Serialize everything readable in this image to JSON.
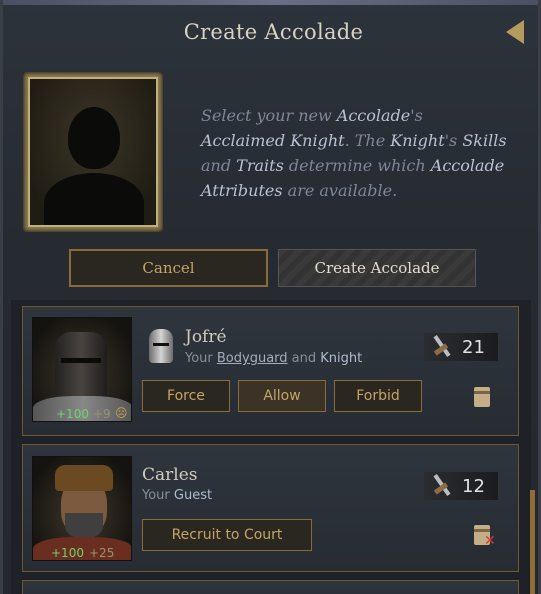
{
  "window": {
    "title": "Create Accolade",
    "back_icon": "back-arrow-icon"
  },
  "intro": {
    "parts": [
      {
        "text": "Select your new ",
        "hl": false
      },
      {
        "text": "Accolade",
        "hl": true
      },
      {
        "text": "'s ",
        "hl": false
      },
      {
        "text": "Acclaimed Knight",
        "hl": true
      },
      {
        "text": ". The ",
        "hl": false
      },
      {
        "text": "Knight",
        "hl": true
      },
      {
        "text": "'s ",
        "hl": false
      },
      {
        "text": "Skills",
        "hl": true
      },
      {
        "text": " and ",
        "hl": false
      },
      {
        "text": "Traits",
        "hl": true
      },
      {
        "text": " determine which ",
        "hl": false
      },
      {
        "text": "Accolade Attributes",
        "hl": true
      },
      {
        "text": " are available.",
        "hl": false
      }
    ]
  },
  "buttons": {
    "cancel": "Cancel",
    "create": "Create Accolade"
  },
  "candidates": [
    {
      "name": "Jofré",
      "role_prefix": "Your ",
      "role_link": "Bodyguard",
      "role_mid": " and ",
      "role_hl": "Knight",
      "prowess": "21",
      "stat_pos": "+100",
      "stat_neg": "+9",
      "options": {
        "force": "Force",
        "allow": "Allow",
        "forbid": "Forbid"
      }
    },
    {
      "name": "Carles",
      "role_prefix": "Your ",
      "role_hl": "Guest",
      "prowess": "12",
      "stat_pos": "+100",
      "stat_neg": "+25",
      "action": "Recruit to Court"
    }
  ],
  "colors": {
    "accent_gold": "#c5a466",
    "highlight_text": "#b7c2d2",
    "positive": "#6fd26b"
  }
}
